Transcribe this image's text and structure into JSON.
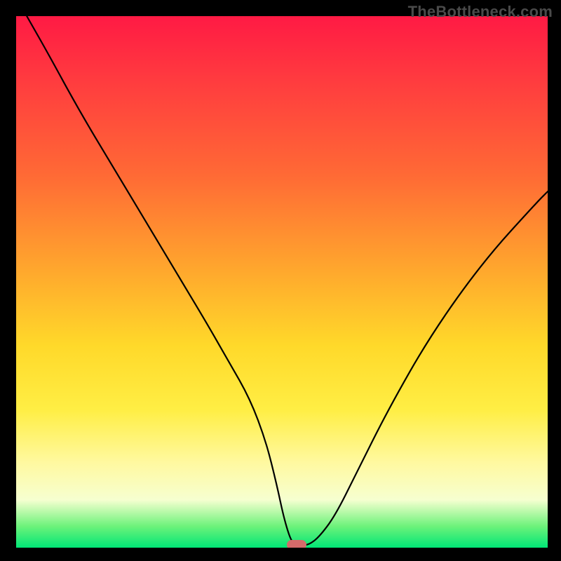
{
  "watermark": "TheBottleneck.com",
  "chart_data": {
    "type": "line",
    "title": "",
    "xlabel": "",
    "ylabel": "",
    "xlim": [
      0,
      100
    ],
    "ylim": [
      0,
      100
    ],
    "grid": false,
    "gradient_background": true,
    "series": [
      {
        "name": "curve",
        "x": [
          2,
          6,
          12,
          18,
          24,
          30,
          36,
          40,
          44,
          47,
          49,
          50.5,
          52,
          53.5,
          55,
          57,
          60,
          64,
          70,
          78,
          88,
          98,
          100
        ],
        "y": [
          100,
          93,
          82,
          72,
          62,
          52,
          42,
          35,
          28,
          20,
          12,
          5,
          0.5,
          0.5,
          0.5,
          2,
          6,
          14,
          26,
          40,
          54,
          65,
          67
        ]
      }
    ],
    "marker": {
      "x": 52.8,
      "y": 0.5,
      "color": "#d46a6a"
    }
  }
}
